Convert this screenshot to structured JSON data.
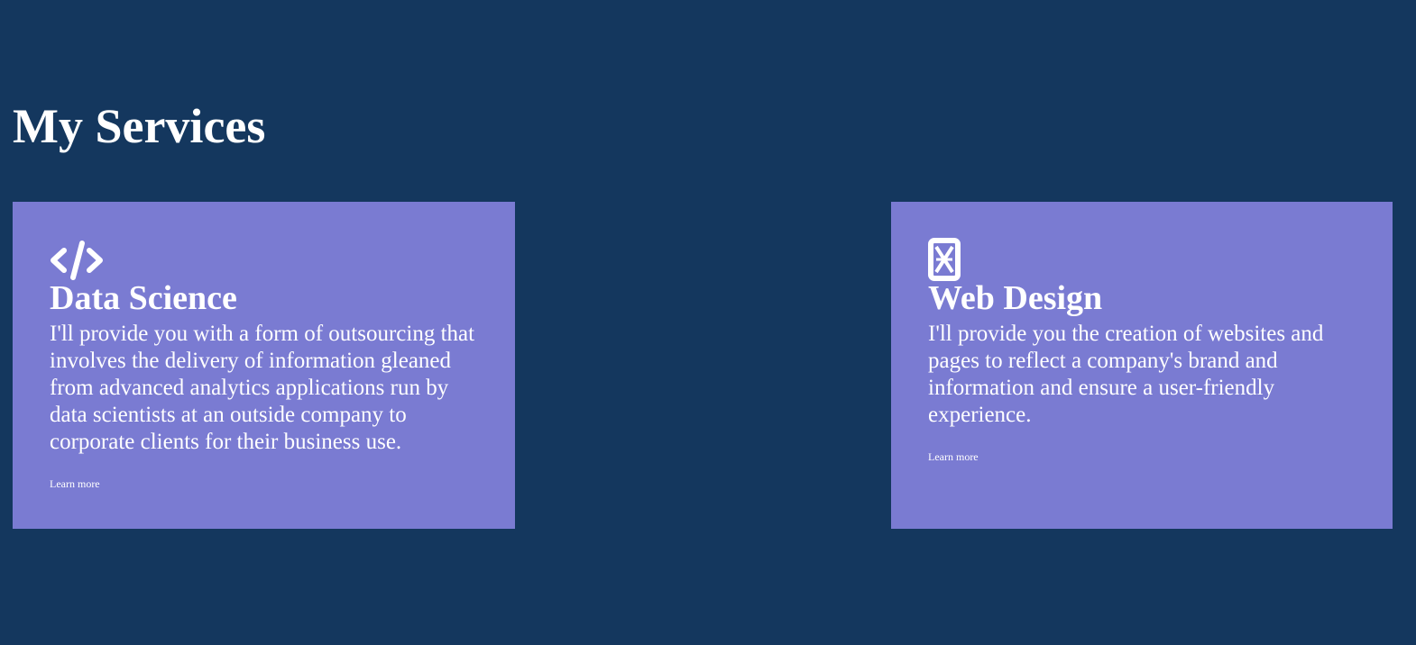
{
  "page": {
    "title": "My Services"
  },
  "services": [
    {
      "icon": "code-icon",
      "title": "Data Science",
      "description": "I'll provide you with a form of outsourcing that involves the delivery of information gleaned from advanced analytics applications run by data scientists at an outside company to corporate clients for their business use.",
      "link_label": "Learn more"
    },
    {
      "icon": "web-design-icon",
      "title": "Web Design",
      "description": "I'll provide you the creation of websites and pages to reflect a company's brand and information and ensure a user-friendly experience.",
      "link_label": "Learn more"
    }
  ],
  "colors": {
    "background": "#14375e",
    "card": "#7a7bd2",
    "text": "#ffffff"
  }
}
